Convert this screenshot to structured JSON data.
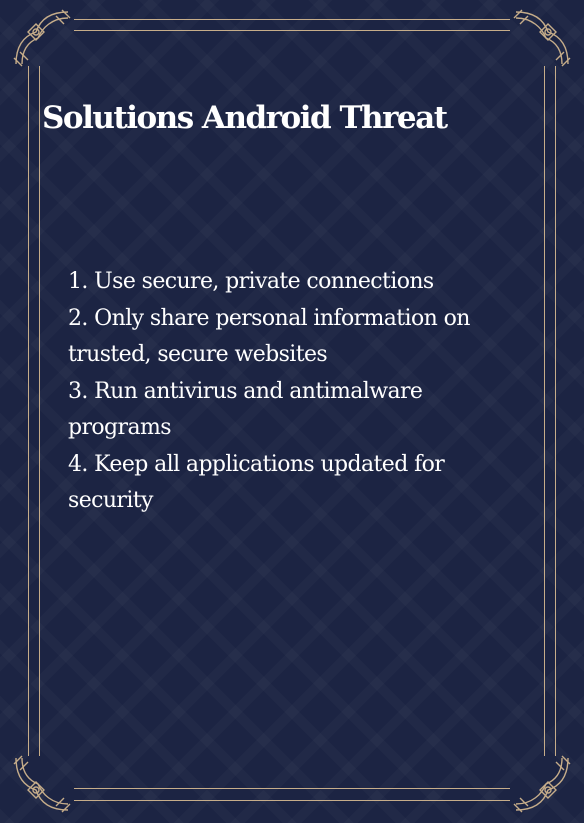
{
  "title": "Solutions Android Threat",
  "items": [
    "1. Use secure, private connections",
    "2. Only share personal information on trusted, secure websites",
    "3. Run antivirus and antimalware programs",
    "4. Keep all applications updated for security"
  ],
  "colors": {
    "background": "#1c2443",
    "frame": "#c6ad8a",
    "text": "#ffffff"
  }
}
